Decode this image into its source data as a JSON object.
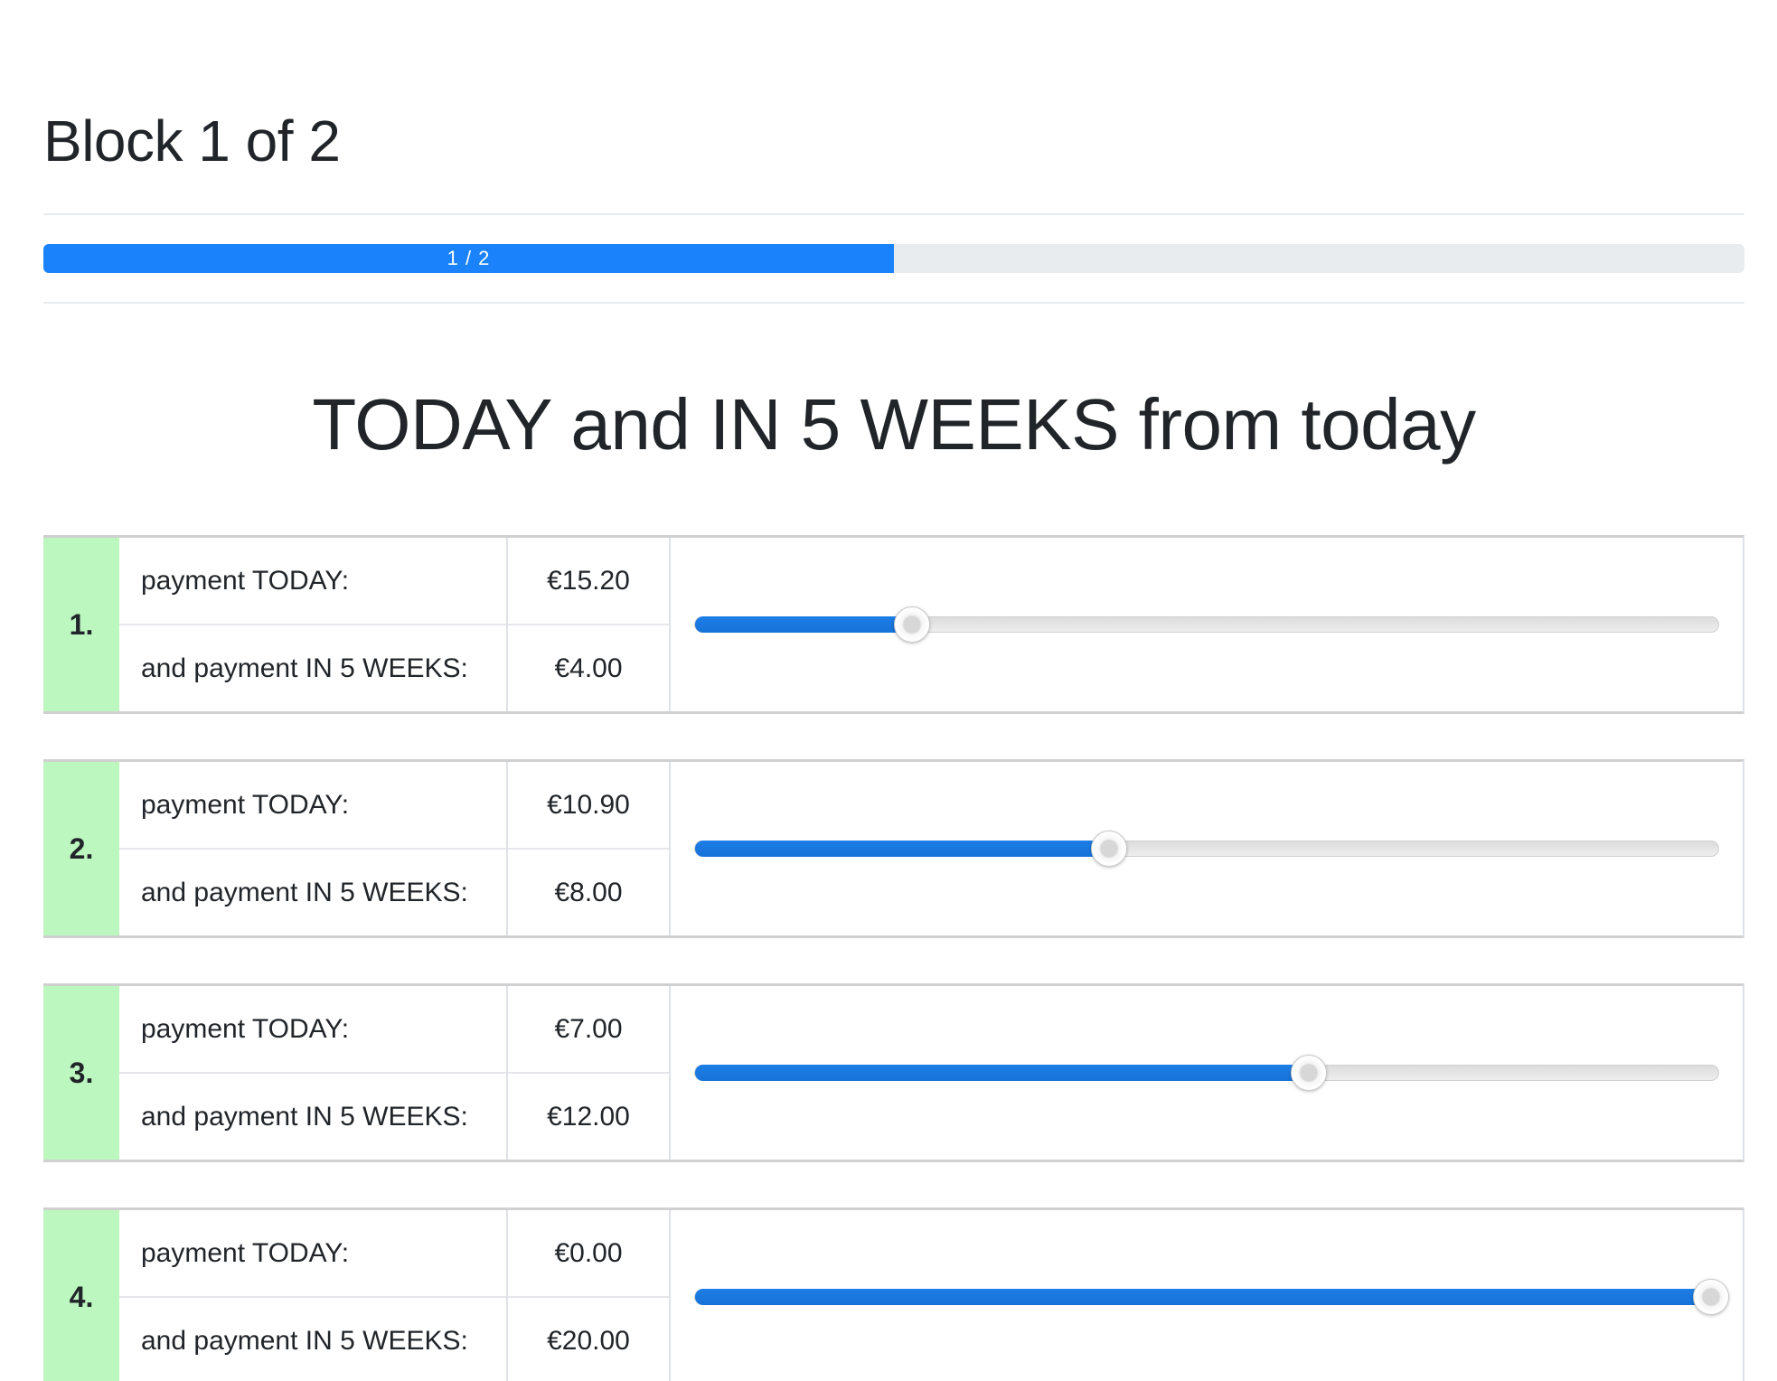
{
  "header": {
    "block_title": "Block 1 of 2",
    "progress": {
      "label": "1 / 2",
      "fraction": 0.5
    }
  },
  "main": {
    "heading": "TODAY and IN 5 WEEKS from today",
    "choices": [
      {
        "number": "1.",
        "today_label": "payment TODAY:",
        "today_amount": "€15.20",
        "later_label": "and payment IN 5 WEEKS:",
        "later_amount": "€4.00",
        "slider_fraction": 0.212
      },
      {
        "number": "2.",
        "today_label": "payment TODAY:",
        "today_amount": "€10.90",
        "later_label": "and payment IN 5 WEEKS:",
        "later_amount": "€8.00",
        "slider_fraction": 0.405
      },
      {
        "number": "3.",
        "today_label": "payment TODAY:",
        "today_amount": "€7.00",
        "later_label": "and payment IN 5 WEEKS:",
        "later_amount": "€12.00",
        "slider_fraction": 0.6
      },
      {
        "number": "4.",
        "today_label": "payment TODAY:",
        "today_amount": "€0.00",
        "later_label": "and payment IN 5 WEEKS:",
        "later_amount": "€20.00",
        "slider_fraction": 1.0
      }
    ]
  },
  "colors": {
    "accent": "#1a82fb",
    "slider_fill": "#1672d8",
    "number_cell_bg": "#bdf7c0",
    "progress_track": "#e9ecef",
    "text": "#212529"
  }
}
